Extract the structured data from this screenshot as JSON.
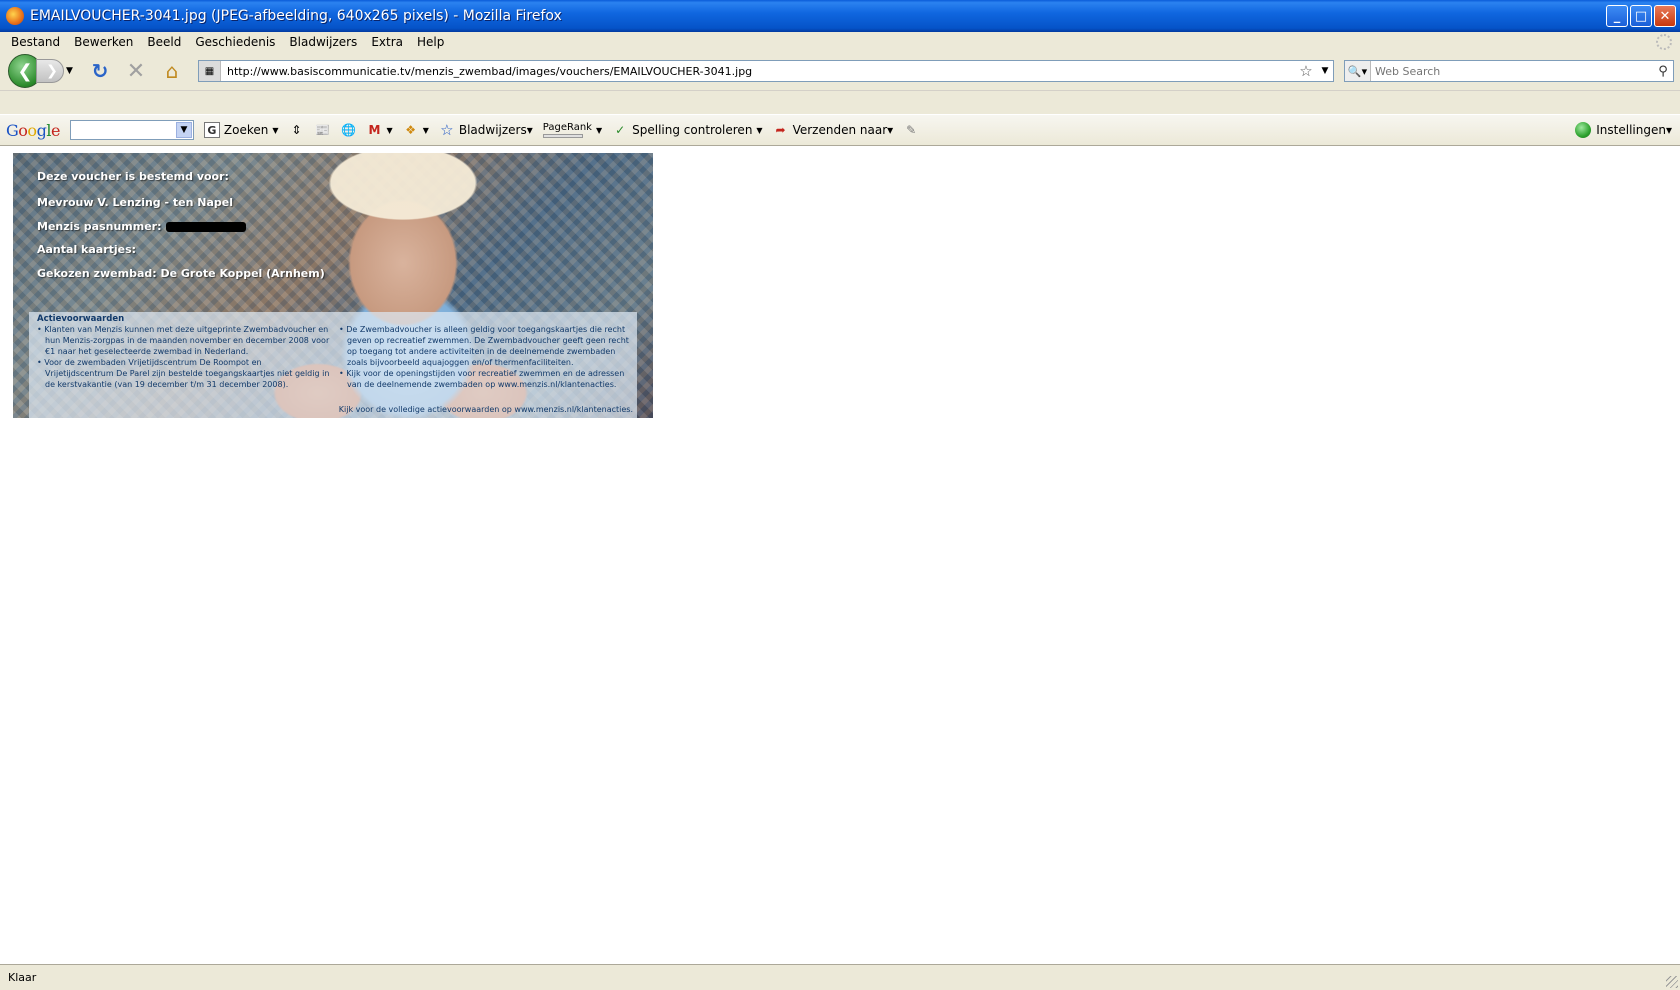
{
  "window": {
    "title": "EMAILVOUCHER-3041.jpg (JPEG-afbeelding, 640x265 pixels) - Mozilla Firefox",
    "minimize": "_",
    "maximize": "□",
    "close": "✕"
  },
  "menu": [
    "Bestand",
    "Bewerken",
    "Beeld",
    "Geschiedenis",
    "Bladwijzers",
    "Extra",
    "Help"
  ],
  "nav": {
    "url": "http://www.basiscommunicatie.tv/menzis_zwembad/images/vouchers/EMAILVOUCHER-3041.jpg",
    "search_placeholder": "Web Search"
  },
  "google_toolbar": {
    "logo": [
      "G",
      "o",
      "o",
      "g",
      "l",
      "e"
    ],
    "zoeken": "Zoeken",
    "bladwijzers": "Bladwijzers▾",
    "pagerank": "PageRank",
    "spelling": "Spelling controleren",
    "verzenden": "Verzenden naar▾",
    "instellingen": "Instellingen▾"
  },
  "voucher": {
    "line1": "Deze voucher is bestemd voor:",
    "line2": "Mevrouw V.  Lenzing - ten Napel",
    "line3": "Menzis pasnummer:",
    "line4": "Aantal kaartjes:",
    "line5": "Gekozen zwembad: De Grote Koppel (Arnhem)",
    "terms_title": "Actievoorwaarden",
    "terms_col1": [
      "• Klanten van Menzis kunnen met deze uitgeprinte Zwembadvoucher en hun Menzis-zorgpas in de maanden november en december 2008 voor €1 naar het geselecteerde zwembad in Nederland.",
      "• Voor de zwembaden Vrijetijdscentrum De Roompot en Vrijetijdscentrum De Parel zijn bestelde toegangskaartjes niet geldig in de kerstvakantie (van 19 december t/m 31 december 2008)."
    ],
    "terms_col2": [
      "• De Zwembadvoucher is alleen geldig voor toegangskaartjes die recht geven op recreatief zwemmen. De Zwembadvoucher geeft geen recht op toegang tot andere activiteiten in de deelnemende zwembaden zoals bijvoorbeeld aquajoggen en/of thermenfaciliteiten.",
      "• Kijk voor de openingstijden voor recreatief zwemmen en de adressen van de deelnemende zwembaden op www.menzis.nl/klantenacties."
    ],
    "terms_footer": "Kijk voor de volledige actievoorwaarden op www.menzis.nl/klantenacties."
  },
  "status": {
    "text": "Klaar"
  },
  "colors": {
    "titlebar": "#0553c8",
    "chrome": "#ece9d8",
    "terms_text": "#123a6a"
  }
}
